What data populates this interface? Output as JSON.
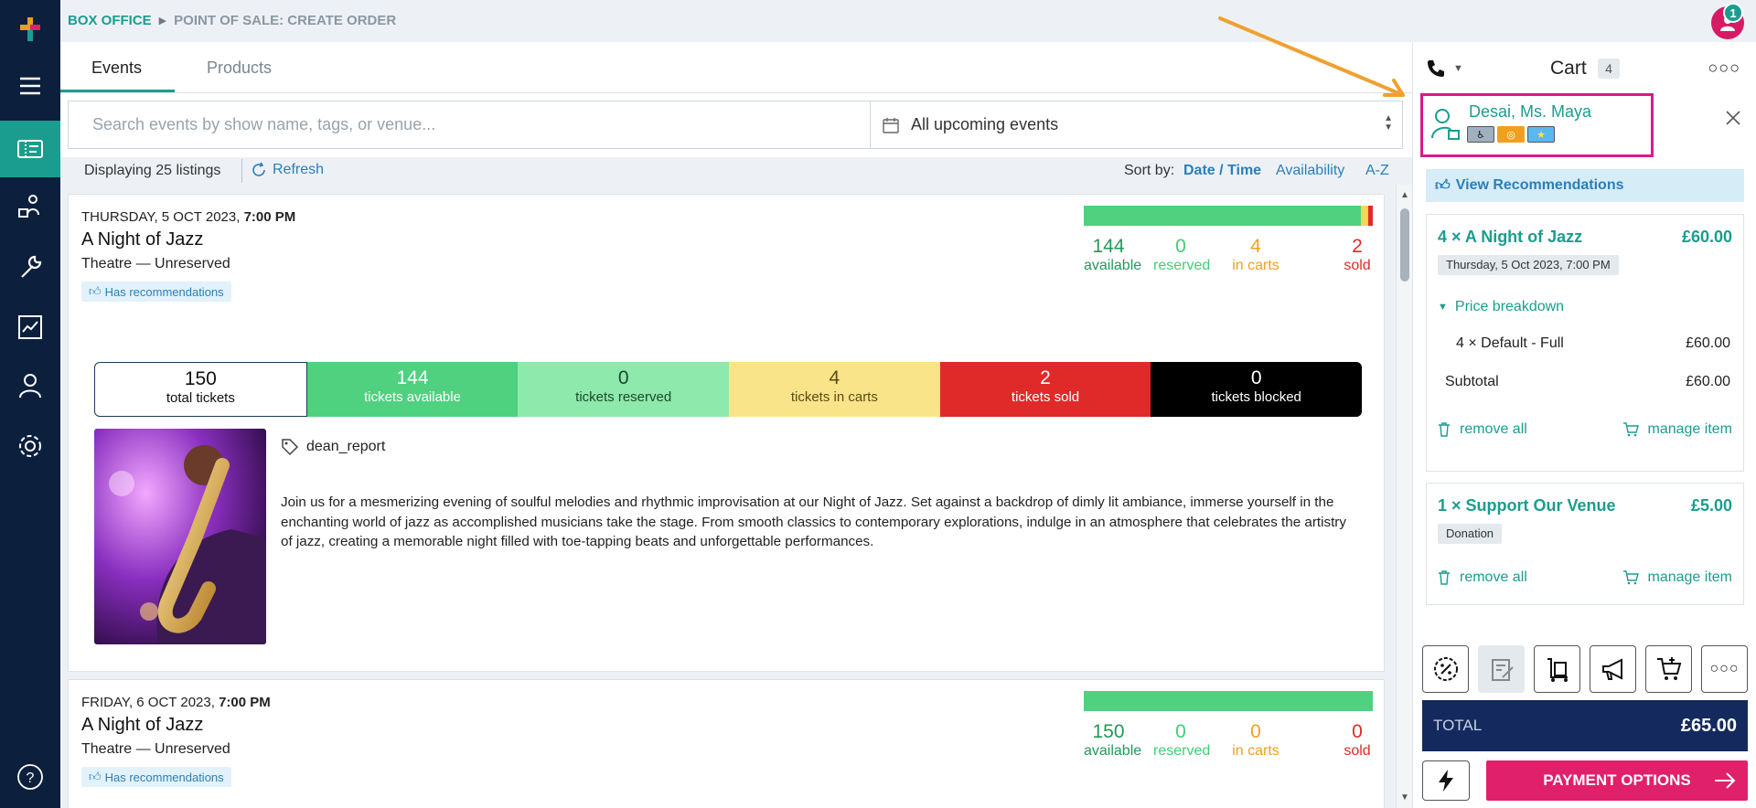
{
  "breadcrumb": {
    "section": "BOX OFFICE",
    "page": "POINT OF SALE: CREATE ORDER"
  },
  "user": {
    "notification_count": "1"
  },
  "tabs": [
    {
      "label": "Events"
    },
    {
      "label": "Products"
    }
  ],
  "search": {
    "placeholder": "Search events by show name, tags, or venue...",
    "value": ""
  },
  "date_filter": {
    "value": "All upcoming events"
  },
  "listing": {
    "count_text": "Displaying 25 listings",
    "refresh_label": "Refresh",
    "sort_label": "Sort by:",
    "sort_options": [
      "Date / Time",
      "Availability",
      "A-Z"
    ]
  },
  "events": [
    {
      "date": "THURSDAY, 5 OCT 2023, ",
      "time": "7:00 PM",
      "title": "A Night of Jazz",
      "venue": "Theatre — Unreserved",
      "badge": "Has recommendations",
      "stats": {
        "available": "144",
        "reserved": "0",
        "in_carts": "4",
        "sold": "2"
      },
      "stat_labels": {
        "available": "available",
        "reserved": "reserved",
        "in_carts": "in carts",
        "sold": "sold"
      },
      "breakdown": [
        {
          "value": "150",
          "label": "total tickets"
        },
        {
          "value": "144",
          "label": "tickets available"
        },
        {
          "value": "0",
          "label": "tickets reserved"
        },
        {
          "value": "4",
          "label": "tickets in carts"
        },
        {
          "value": "2",
          "label": "tickets sold"
        },
        {
          "value": "0",
          "label": "tickets blocked"
        }
      ],
      "tag": "dean_report",
      "description": "Join us for a mesmerizing evening of soulful melodies and rhythmic improvisation at our Night of Jazz. Set against a backdrop of dimly lit ambiance, immerse yourself in the enchanting world of jazz as accomplished musicians take the stage. From smooth classics to contemporary explorations, indulge in an atmosphere that celebrates the artistry of jazz, creating a memorable night filled with toe-tapping beats and unforgettable performances."
    },
    {
      "date": "FRIDAY, 6 OCT 2023, ",
      "time": "7:00 PM",
      "title": "A Night of Jazz",
      "venue": "Theatre — Unreserved",
      "badge": "Has recommendations",
      "stats": {
        "available": "150",
        "reserved": "0",
        "in_carts": "0",
        "sold": "0"
      },
      "stat_labels": {
        "available": "available",
        "reserved": "reserved",
        "in_carts": "in carts",
        "sold": "sold"
      }
    }
  ],
  "cart": {
    "title": "Cart",
    "count": "4",
    "customer": {
      "name": "Desai, Ms. Maya"
    },
    "view_recommendations": "View Recommendations",
    "items": [
      {
        "title": "4 × A Night of Jazz",
        "price": "£60.00",
        "subtitle": "Thursday, 5 Oct 2023, 7:00 PM",
        "breakdown_label": "Price breakdown",
        "lines": [
          {
            "label": "4 × Default - Full",
            "value": "£60.00"
          }
        ],
        "subtotal_label": "Subtotal",
        "subtotal": "£60.00",
        "remove_label": "remove all",
        "manage_label": "manage item"
      },
      {
        "title": "1 × Support Our Venue",
        "price": "£5.00",
        "subtitle": "Donation",
        "remove_label": "remove all",
        "manage_label": "manage item"
      }
    ],
    "total_label": "TOTAL",
    "total_value": "£65.00",
    "payment_label": "PAYMENT OPTIONS"
  },
  "colors": {
    "accent": "#1a9d8f",
    "sidebar": "#0c1f3d",
    "payment": "#e0206a",
    "total_bar": "#142a5e"
  }
}
